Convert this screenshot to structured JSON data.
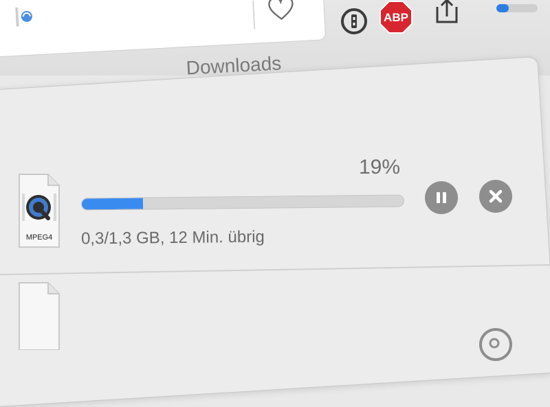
{
  "popover": {
    "title": "Downloads"
  },
  "toolbar": {
    "abp_label": "ABP",
    "progress_fraction": 0.3
  },
  "downloads": [
    {
      "file_type": "MPEG4",
      "percent": "19%",
      "progress_fraction": 0.19,
      "status": "0,3/1,3 GB, 12 Min. übrig",
      "icons": [
        "quicktime-file-icon",
        "pause-icon",
        "close-icon"
      ]
    },
    {
      "icons": [
        "blank-file-icon",
        "magnifier-icon"
      ]
    }
  ],
  "colors": {
    "accent": "#3a8bf0",
    "abp_red": "#d7262e",
    "button_gray": "#8e8e8e",
    "text_gray": "#6a6a6a"
  }
}
